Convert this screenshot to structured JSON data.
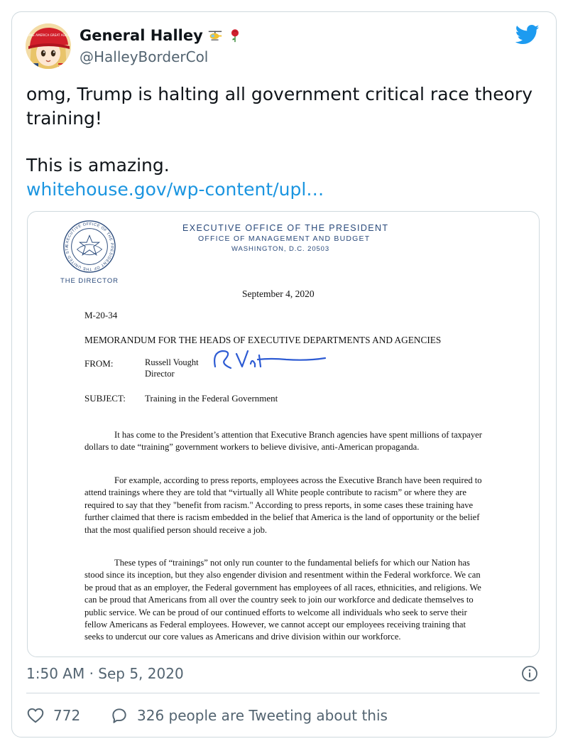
{
  "author": {
    "display_name": "General Halley",
    "handle": "@HalleyBorderCol",
    "name_emoji": [
      "helicopter-emoji",
      "rose-emoji"
    ],
    "avatar": "anime-character-red-cap-avatar",
    "avatar_cap_text": "MAKE AMERICA GREAT AGAIN"
  },
  "tweet": {
    "line1": "omg, Trump is halting all government critical race theory training!",
    "line2": "This is amazing.",
    "link": "whitehouse.gov/wp-content/upl…"
  },
  "document": {
    "seal_text": "EXECUTIVE OFFICE OF THE PRESIDENT OF THE UNITED STATES",
    "office": "EXECUTIVE OFFICE OF THE PRESIDENT",
    "agency": "OFFICE OF MANAGEMENT AND BUDGET",
    "address": "WASHINGTON, D.C. 20503",
    "director_label": "THE DIRECTOR",
    "date": "September 4, 2020",
    "memo_number": "M-20-34",
    "memo_title": "MEMORANDUM FOR THE HEADS OF EXECUTIVE DEPARTMENTS AND AGENCIES",
    "from_label": "FROM:",
    "from_name": "Russell Vought",
    "from_title": "Director",
    "subject_label": "SUBJECT:",
    "subject": "Training in the Federal Government",
    "paragraph1": "It has come to the President’s attention that Executive Branch agencies have spent millions of taxpayer dollars to date “training” government workers to believe divisive, anti-American propaganda.",
    "paragraph2": "For example, according to press reports, employees across the Executive Branch have been required to attend trainings where they are told that “virtually all White people contribute to racism” or where they are required to say that they \"benefit from racism.\" According to press reports, in some cases these training have further claimed that there is racism embedded in the belief that America is the land of opportunity or the belief that the most qualified person should receive a job.",
    "paragraph3": "These types of “trainings” not only run counter to the fundamental beliefs for which our Nation has stood since its inception, but they also engender division and resentment within the Federal workforce.  We can be proud that as an employer, the Federal government has employees of all races, ethnicities, and religions. We can be proud that Americans from all over the country seek to join our workforce and dedicate themselves to public service. We can be proud of our continued efforts to welcome all individuals who seek to serve their fellow Americans as Federal employees. However, we cannot accept our employees receiving training that seeks to undercut our core values as Americans and drive division within our workforce."
  },
  "footer": {
    "timestamp": "1:50 AM · Sep 5, 2020",
    "like_count": "772",
    "reply_text": "326 people are Tweeting about this"
  },
  "colors": {
    "link": "#1b95e0",
    "twitter_blue": "#1d9bf0",
    "muted": "#536471",
    "border": "#cfd9de",
    "letterhead": "#2a4a7b",
    "signature": "#2d5bd3"
  }
}
